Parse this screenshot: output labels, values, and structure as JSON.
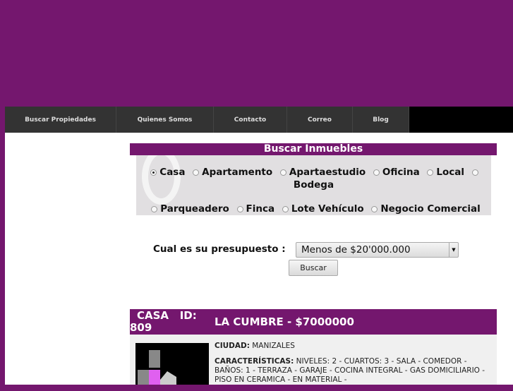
{
  "nav": {
    "items": [
      "Buscar Propiedades",
      "Quienes Somos",
      "Contacto",
      "Correo",
      "Blog"
    ]
  },
  "search": {
    "title": "Buscar Inmuebles",
    "options": [
      "Casa",
      "Apartamento",
      "Apartaestudio",
      "Oficina",
      "Local",
      "Bodega",
      "Parqueadero",
      "Finca",
      "Lote Vehículo",
      "Negocio Comercial"
    ],
    "selected": "Casa",
    "budget_label": "Cual es su presupuesto :",
    "budget_value": "Menos de $20'000.000",
    "button": "Buscar"
  },
  "listing": {
    "type_id_a": "CASA   ID:",
    "type_id_b": "809",
    "title": "LA CUMBRE - $7000000",
    "city_label": "CIUDAD:",
    "city": "MANIZALES",
    "features_label": "CARACTERÍSTICAS:",
    "features": "NIVELES: 2 - CUARTOS: 3 - SALA - COMEDOR - BAÑOS: 1 - TERRAZA - GARAJE - COCINA INTEGRAL - GAS DOMICILIARIO - PISO EN CERAMICA - EN MATERIAL -"
  },
  "colors": {
    "brand": "#74176e",
    "nav": "#333333"
  }
}
